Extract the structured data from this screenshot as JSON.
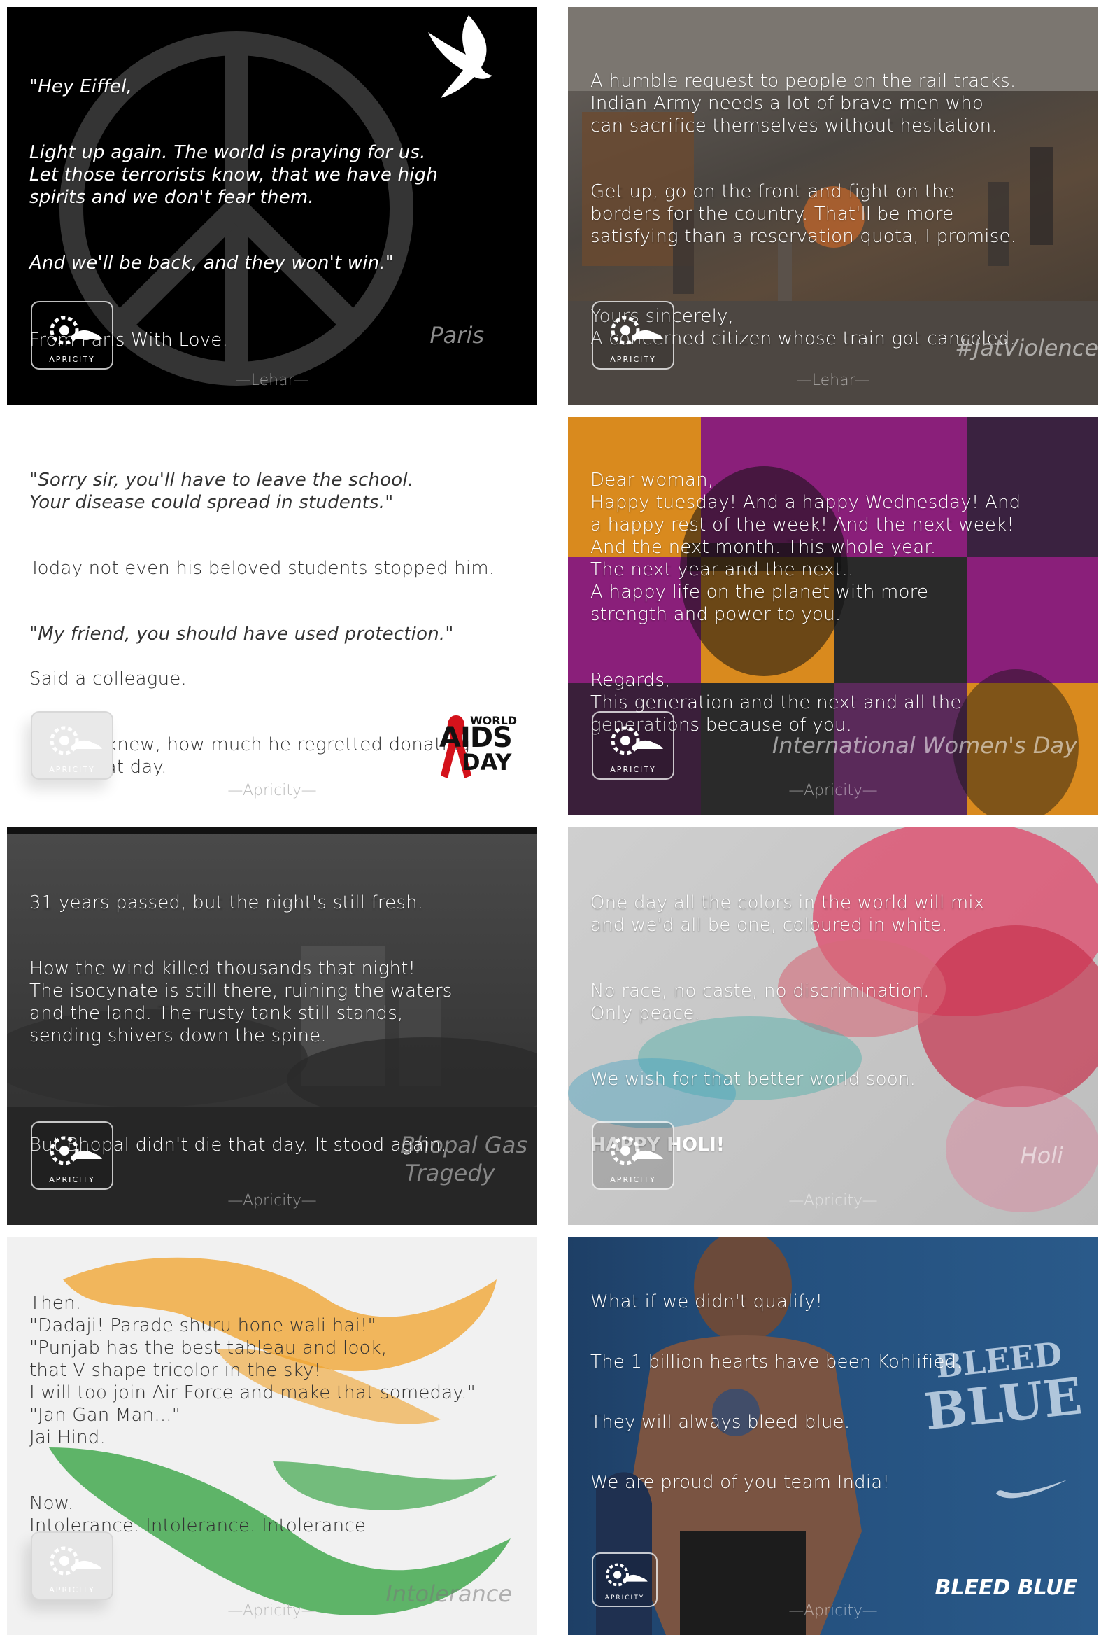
{
  "brand": {
    "logo_text": "APRICITY"
  },
  "cards": [
    {
      "id": "paris",
      "lines_italic": [
        "\"Hey Eiffel,",
        "Light up again. The world is praying for us.\nLet those terrorists know, that we have high\nspirits and we don't fear them.",
        "And we'll be back, and they won't win.\""
      ],
      "closing": "From Paris With Love.",
      "tag": "Paris",
      "signature": "—Lehar—"
    },
    {
      "id": "jat",
      "p1": "A humble request to people on the rail tracks.\nIndian Army needs a lot of brave men who\ncan sacrifice themselves without hesitation.",
      "p2": "Get up, go on the front and fight on the\nborders for the country. That'll be more\nsatisfying than a reservation quota, I promise.",
      "p3": "Yours sincerely,\nA concerned citizen whose train got canceled.",
      "tag": "#JatViolence",
      "signature": "—Lehar—"
    },
    {
      "id": "aids",
      "p1": "\"Sorry sir, you'll have to leave the school.\nYour disease could spread in students.\"",
      "p2": "Today not even his beloved students stopped him.",
      "p3": "\"My friend, you should have used protection.\"",
      "p3b": "Said a colleague.",
      "p4": "Only he knew, how much he regretted donating\nblood that day.",
      "badge_world": "WORLD",
      "badge_aids": "AIDS",
      "badge_day": "DAY",
      "signature": "—Apricity—"
    },
    {
      "id": "women",
      "p1": "Dear woman,\nHappy tuesday! And a happy Wednesday! And\na happy rest of the week! And the next week!\nAnd the next month. This whole year.\nThe next year and the next..\nA happy life on the planet with more\nstrength and power to you.",
      "p2": "Regards,\nThis generation and the next and all the\ngenerations because of you.",
      "tag": "International Women's Day",
      "signature": "—Apricity—"
    },
    {
      "id": "bhopal",
      "p1": "31 years passed, but the night's still fresh.",
      "p2": "How the wind killed thousands that night!\nThe isocynate is still there, ruining the waters\nand the land. The rusty tank still stands,\nsending shivers down the spine.",
      "p3": "But Bhopal didn't die that day. It stood again.",
      "tag1": "Bhopal Gas",
      "tag2": "Tragedy",
      "signature": "—Apricity—"
    },
    {
      "id": "holi",
      "p1": "One day all the colors in the world will mix\nand we'd all be one, coloured in white.",
      "p2": "No race, no caste, no discrimination.\nOnly peace.",
      "p3": "We wish for that better world soon.",
      "p4": "HAPPY HOLI!",
      "tag": "Holi",
      "signature": "—Apricity—"
    },
    {
      "id": "intolerance",
      "p1": "Then.\n\"Dadaji! Parade shuru hone wali hai!\"\n\"Punjab has the best tableau and look,\nthat V shape tricolor in the sky!\nI will too join Air Force and make that someday.\"\n\"Jan Gan Man...\"\nJai Hind.",
      "p2": "Now.\nIntolerance. Intolerance. Intolerance",
      "tag": "Intolerance",
      "signature": "—Apricity—"
    },
    {
      "id": "bleedblue",
      "p1": "What if we didn't qualify!",
      "p2": "The 1 billion hearts have been Kohlified.",
      "p3": "They will always bleed blue.",
      "p4": "We are proud of you team India!",
      "graffiti1": "BLEED",
      "graffiti2": "BLUE",
      "tag": "BLEED BLUE",
      "signature": "—Apricity—"
    }
  ],
  "colors": {
    "paris_bg": "#000000",
    "women_orange": "#d98a1e",
    "women_purple": "#8a1f7a",
    "holi_pink": "#e0476a",
    "flag_saffron": "#f0a12a",
    "flag_green": "#1f9a2e",
    "bleed_blue": "#24507e",
    "aids_red": "#d4121b"
  }
}
